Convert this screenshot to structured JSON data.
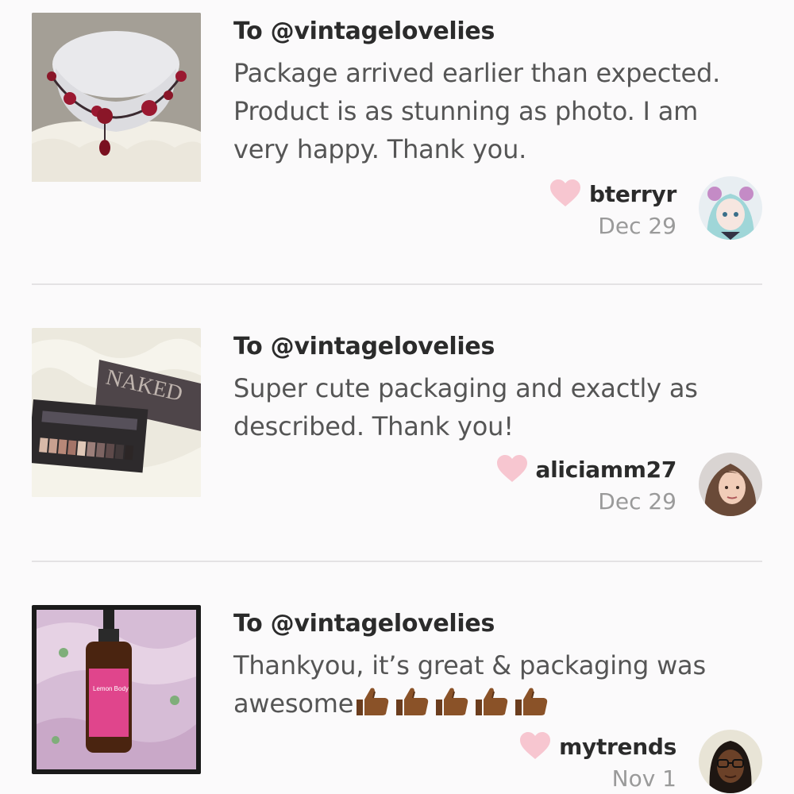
{
  "reviews": [
    {
      "to": "To @vintagelovelies",
      "body": "Package arrived earlier than expected. Product is as stunning as photo. I am very happy. Thank you.",
      "username": "bterryr",
      "date": "Dec 29",
      "thumb_icon": "necklace-photo",
      "avatar_icon": "anime-avatar"
    },
    {
      "to": "To @vintagelovelies",
      "body": "Super cute packaging and exactly as described. Thank you!",
      "username": "aliciamm27",
      "date": "Dec 29",
      "thumb_icon": "eyeshadow-palette-photo",
      "avatar_icon": "woman-avatar"
    },
    {
      "to": "To @vintagelovelies",
      "body": "Thankyou, it’s great & packaging was awesome",
      "body_emoji": "👍🏾👍🏾👍🏾👍🏾👍🏾",
      "username": "mytrends",
      "date": "Nov 1",
      "thumb_icon": "serum-bottle-photo",
      "avatar_icon": "glasses-woman-avatar"
    }
  ],
  "colors": {
    "heart": "#f7c6d0",
    "divider": "#e4e2e4",
    "date": "#9a9a9a",
    "body": "#555555"
  }
}
